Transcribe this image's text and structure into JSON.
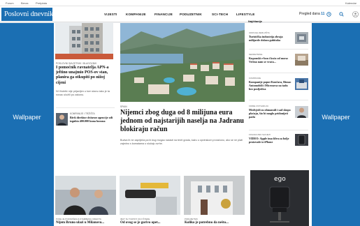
{
  "topbar": {
    "links": [
      "Forum",
      "Berza",
      "Pretplata"
    ],
    "right_text": "Kalendar"
  },
  "nav": {
    "logo": "Poslovni dnevnik",
    "items": [
      "VIJESTI",
      "KOMPANIJE",
      "FINANCIJE",
      "PODUZETNIK",
      "SCI-TECH",
      "LIFESTYLE"
    ],
    "day_label": "Pregled dana",
    "day_count": "11"
  },
  "wallpaper": {
    "left": "Wallpaper",
    "right": "Wallpaper"
  },
  "left_col": {
    "story1": {
      "category": "POSLOVNI SAVJETNIK / BLAGOVNIK",
      "headline": "I pomoćnik ravnatelja APN-a jeftino unajmio POS-ov stan, planira ga otkupiti po nižoj cijeni",
      "summary": "Ni Violetić nije prijavljen u tom stanu iako je ta novac uložili po zakonu."
    },
    "story2": {
      "category": "KOMPANIJE I TRŽIŠTA",
      "headline": "Bivši direktor državne agencije ođi izgubio 400.000 kuna bonusa"
    }
  },
  "main_story": {
    "category": "SPAIN",
    "headline": "Nijemci zbog duga od 8 milijuna eura jednom od najstarijih naselja na Jadranu blokiraju račun",
    "summary": "Budva ih ne zapriječa pa bi dug mogao narasti na teret grada, kažu u općinskom proračunu, ako se ne plati zajedno s kamatama u slučaju ovrhe."
  },
  "right_col": {
    "header": "Najčitanije",
    "items": [
      {
        "category": "UDRUGE ZEMLJIŠTA",
        "headline": "Turistička industrija zbraja milijarde dolara gubitaka"
      },
      {
        "category": "NEKRETNINE",
        "headline": "Kuponski e-bon i kuća od mora: Većina nam se vraća..."
      },
      {
        "category": "KOMPANIJE",
        "headline": "Kompanije poput Končara, Rimac Automobili i Microsova na tadu bez posljedica"
      },
      {
        "category": "FIRME OSTVARUJU",
        "headline": "Medvjedi su obmanuli i sad skupo plaćaju, što bi moglo pridonijeti padu"
      },
      {
        "category": "FINANCIJSKI SAVJETI",
        "headline": "VIDEO: Apple ima šifru za bolje proizvode iz iPhone"
      }
    ]
  },
  "bottom_row": [
    {
      "category": "PUNE JE PODNOŠENJA STAMBENIH KREDITA",
      "headline": "Nijem Bruno ulazi u Milanovu..."
    },
    {
      "category": "IMAT SU TURISTI KOJI ŠTEDE",
      "headline": "Od ovog se je gorivo opet..."
    },
    {
      "category": "PODUZETNIK",
      "headline": "Koliko je potrebno da nešto..."
    },
    {
      "category": "",
      "headline": "ego"
    }
  ],
  "colors": {
    "brand": "#1b6fb3",
    "text": "#111111"
  }
}
